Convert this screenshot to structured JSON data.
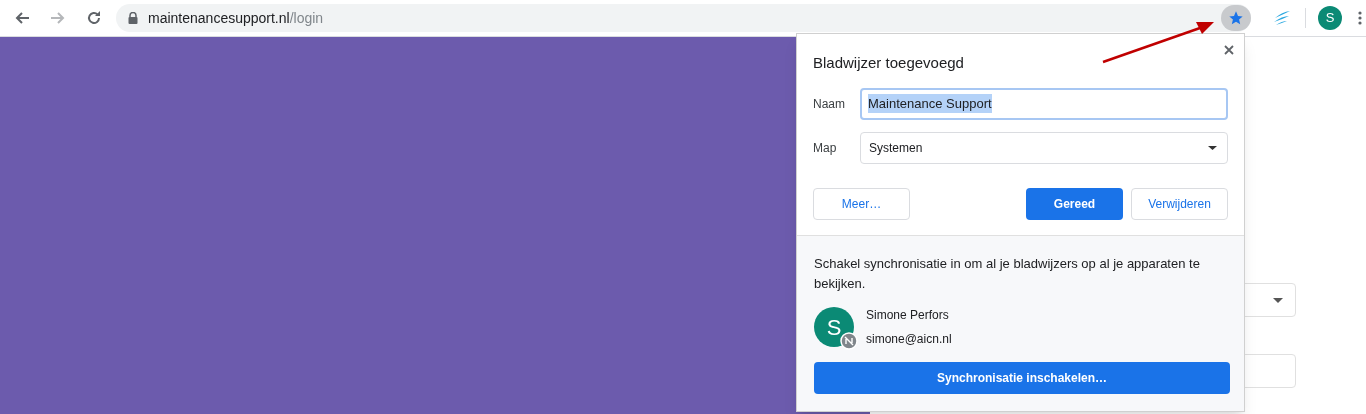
{
  "browser": {
    "url_host": "maintenancesupport.nl",
    "url_path": "/login",
    "bookmarked": true,
    "profile_initial": "S"
  },
  "dialog": {
    "title": "Bladwijzer toegevoegd",
    "name_label": "Naam",
    "name_value": "Maintenance Support",
    "name_selected": true,
    "folder_label": "Map",
    "folder_value": "Systemen",
    "buttons": [
      {
        "label": "Meer…",
        "kind": "secondary"
      },
      {
        "label": "Gereed",
        "kind": "primary"
      },
      {
        "label": "Verwijderen",
        "kind": "secondary"
      }
    ],
    "sync_text": "Schakel synchronisatie in om al je bladwijzers op al je apparaten te bekijken.",
    "account": {
      "initial": "S",
      "name": "Simone Perfors",
      "email": "simone@aicn.nl"
    },
    "sync_button": "Synchronisatie inschakelen…"
  }
}
